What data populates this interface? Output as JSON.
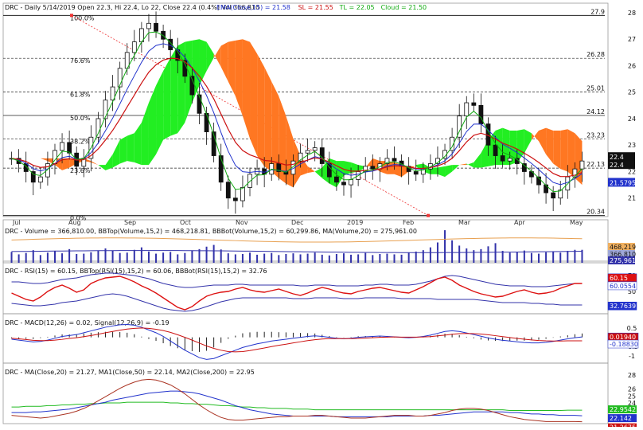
{
  "colors": {
    "candle": "#111111",
    "ema": "#2233cc",
    "sl": "#cc1111",
    "tl": "#11aa11",
    "cloud_green": "#22ee22",
    "cloud_orange": "#ff7722",
    "volume_bar": "#3333aa",
    "bb_upper": "#e8a050",
    "bb_lower": "#3333aa",
    "rsi": "#dd1111",
    "macd": "#2233cc",
    "signal": "#cc1111",
    "ma20": "#aa3322",
    "ma50": "#2233cc",
    "ma200": "#22bb22",
    "fib_line": "#222222",
    "trend_dotted": "#ee3333"
  },
  "chart_data": [
    {
      "type": "candlestick",
      "title": "DRC - Daily 5/14/2019 Open 22.3, Hi 22.4, Lo 22, Close 22.4 (0.4%) Vol 366,810",
      "legend": [
        {
          "text": "EMA(Close,15) = 21.58",
          "color": "#2233cc"
        },
        {
          "text": "SL = 21.55",
          "color": "#cc1111"
        },
        {
          "text": "TL = 22.05",
          "color": "#11aa11"
        },
        {
          "text": "Cloud = 21.50",
          "color": "#11aa11"
        }
      ],
      "x_labels": [
        "Jul",
        "Aug",
        "Sep",
        "Oct",
        "Nov",
        "Dec",
        "2019",
        "Feb",
        "Mar",
        "Apr",
        "May"
      ],
      "y_ticks": [
        21,
        22,
        23,
        24,
        25,
        26,
        27,
        28
      ],
      "ylim": [
        20.3,
        28.0
      ],
      "last_values": [
        "22.4",
        "22.4",
        "21.5795"
      ],
      "fib_levels": [
        {
          "label": "100.0%",
          "value": 27.9
        },
        {
          "label": "76.6%",
          "value": 26.28
        },
        {
          "label": "61.8%",
          "value": 25.01
        },
        {
          "label": "50.0%",
          "value": 24.12
        },
        {
          "label": "38.2%",
          "value": 23.23
        },
        {
          "label": "23.6%",
          "value": 22.13
        },
        {
          "label": "0.0%",
          "value": 20.34
        }
      ],
      "close_series": [
        22.5,
        22.3,
        22.0,
        21.6,
        21.8,
        22.3,
        22.8,
        23.1,
        22.7,
        22.2,
        22.5,
        23.3,
        24.0,
        24.7,
        25.2,
        25.9,
        26.5,
        26.9,
        27.4,
        27.6,
        27.3,
        27.0,
        26.6,
        26.2,
        25.6,
        24.9,
        24.2,
        23.5,
        22.6,
        21.6,
        21.0,
        20.9,
        21.4,
        21.9,
        22.1,
        21.9,
        22.3,
        22.0,
        21.9,
        22.4,
        22.7,
        22.8,
        22.9,
        22.3,
        21.8,
        21.6,
        21.5,
        21.7,
        22.0,
        22.2,
        22.1,
        22.3,
        22.5,
        22.4,
        22.2,
        22.0,
        21.9,
        22.1,
        22.3,
        22.5,
        22.8,
        23.3,
        24.1,
        24.6,
        24.5,
        23.8,
        23.0,
        22.6,
        22.4,
        22.5,
        22.3,
        22.0,
        21.8,
        21.5,
        21.2,
        21.0,
        21.3,
        21.8,
        22.1,
        22.4
      ]
    },
    {
      "type": "bar",
      "title": "DRC - Volume = 366,810.00, BBTop(Volume,15,2) = 468,218.81, BBBot(Volume,15,2) = 60,299.86, MA(Volume,20) = 275,961.00",
      "last_values": [
        "468,219",
        "366,810",
        "275,961"
      ],
      "values": [
        3.1,
        2.4,
        2.8,
        3.6,
        2.2,
        2.9,
        3.3,
        2.7,
        3.9,
        2.5,
        2.6,
        3.0,
        3.4,
        4.1,
        3.5,
        2.8,
        2.9,
        3.7,
        4.4,
        3.2,
        2.6,
        2.9,
        3.1,
        2.4,
        2.8,
        3.5,
        3.9,
        4.6,
        5.1,
        3.8,
        2.7,
        2.4,
        2.5,
        2.9,
        2.3,
        2.6,
        2.8,
        2.2,
        2.5,
        2.7,
        2.4,
        2.6,
        2.9,
        2.3,
        2.1,
        2.5,
        2.7,
        2.3,
        2.4,
        2.8,
        2.2,
        2.5,
        2.6,
        2.4,
        2.3,
        2.9,
        3.2,
        3.6,
        4.4,
        5.8,
        9.3,
        6.4,
        4.9,
        4.1,
        3.6,
        3.9,
        4.7,
        5.6,
        3.4,
        2.9,
        3.1,
        3.5,
        2.8,
        2.6,
        3.0,
        3.3,
        2.9,
        3.4,
        3.7,
        3.7
      ],
      "ylim": [
        0,
        10
      ]
    },
    {
      "type": "line",
      "title": "DRC - RSI(15) = 60.15, BBTop(RSI(15),15,2) = 60.06, BBBot(RSI(15),15,2) = 32.76",
      "y_ticks": [
        30,
        50,
        70
      ],
      "ylim": [
        22,
        78
      ],
      "last_values": [
        "60.15",
        "60.0554",
        "32.7639"
      ],
      "rsi": [
        48,
        44,
        40,
        38,
        43,
        50,
        55,
        58,
        54,
        49,
        52,
        60,
        64,
        67,
        68,
        69,
        66,
        62,
        57,
        53,
        48,
        42,
        36,
        30,
        27,
        31,
        38,
        44,
        47,
        49,
        50,
        53,
        55,
        52,
        50,
        49,
        51,
        53,
        50,
        47,
        45,
        48,
        52,
        55,
        53,
        50,
        48,
        47,
        50,
        52,
        54,
        55,
        53,
        51,
        49,
        48,
        52,
        56,
        61,
        66,
        68,
        64,
        58,
        54,
        50,
        47,
        45,
        43,
        44,
        47,
        50,
        52,
        49,
        47,
        48,
        50,
        54,
        57,
        60,
        60
      ],
      "bb_top": [
        62,
        62,
        61,
        60,
        60,
        61,
        63,
        65,
        66,
        67,
        69,
        71,
        72,
        73,
        73,
        72,
        71,
        70,
        68,
        66,
        63,
        60,
        58,
        56,
        55,
        55,
        56,
        57,
        58,
        58,
        58,
        59,
        59,
        58,
        58,
        58,
        58,
        58,
        58,
        58,
        57,
        57,
        58,
        58,
        58,
        57,
        57,
        57,
        57,
        58,
        58,
        59,
        59,
        58,
        58,
        58,
        59,
        61,
        63,
        66,
        69,
        70,
        69,
        67,
        65,
        63,
        61,
        59,
        58,
        57,
        57,
        57,
        56,
        56,
        56,
        57,
        58,
        59,
        60,
        60
      ],
      "bb_bot": [
        35,
        34,
        33,
        32,
        32,
        33,
        34,
        36,
        37,
        38,
        40,
        42,
        44,
        46,
        47,
        46,
        44,
        41,
        38,
        35,
        32,
        29,
        27,
        26,
        25,
        26,
        28,
        31,
        34,
        37,
        39,
        41,
        42,
        42,
        42,
        42,
        42,
        42,
        42,
        41,
        41,
        41,
        42,
        42,
        42,
        42,
        41,
        41,
        41,
        42,
        42,
        42,
        42,
        42,
        41,
        41,
        41,
        41,
        41,
        40,
        40,
        40,
        40,
        40,
        40,
        39,
        38,
        37,
        36,
        36,
        36,
        36,
        35,
        35,
        34,
        34,
        33,
        33,
        33,
        33
      ]
    },
    {
      "type": "bar",
      "title": "DRC - MACD(12,26) = 0.02, Signal(12,26,9) = -0.19",
      "y_ticks": [
        0.5,
        0,
        -0.5,
        -1.0
      ],
      "ylim": [
        -1.4,
        0.85
      ],
      "last_values": [
        "0.01940",
        "-0.18830"
      ],
      "macd": [
        -0.1,
        -0.15,
        -0.2,
        -0.25,
        -0.22,
        -0.15,
        -0.05,
        0.05,
        0.1,
        0.15,
        0.25,
        0.35,
        0.45,
        0.55,
        0.62,
        0.68,
        0.7,
        0.66,
        0.55,
        0.4,
        0.25,
        0.05,
        -0.2,
        -0.45,
        -0.7,
        -0.9,
        -1.1,
        -1.2,
        -1.15,
        -1.0,
        -0.85,
        -0.7,
        -0.55,
        -0.45,
        -0.35,
        -0.28,
        -0.2,
        -0.15,
        -0.1,
        -0.05,
        0.0,
        0.05,
        0.08,
        0.05,
        0.0,
        -0.05,
        -0.08,
        -0.05,
        0.0,
        0.03,
        0.05,
        0.07,
        0.05,
        0.03,
        0.0,
        -0.02,
        0.0,
        0.05,
        0.12,
        0.22,
        0.32,
        0.36,
        0.32,
        0.24,
        0.15,
        0.06,
        -0.03,
        -0.1,
        -0.16,
        -0.2,
        -0.24,
        -0.28,
        -0.3,
        -0.3,
        -0.27,
        -0.22,
        -0.15,
        -0.08,
        -0.02,
        0.02
      ],
      "signal": [
        -0.05,
        -0.08,
        -0.12,
        -0.16,
        -0.18,
        -0.18,
        -0.15,
        -0.11,
        -0.06,
        -0.02,
        0.04,
        0.1,
        0.17,
        0.25,
        0.32,
        0.39,
        0.45,
        0.49,
        0.51,
        0.49,
        0.44,
        0.37,
        0.27,
        0.14,
        0.0,
        -0.15,
        -0.31,
        -0.47,
        -0.6,
        -0.7,
        -0.77,
        -0.79,
        -0.77,
        -0.72,
        -0.65,
        -0.58,
        -0.5,
        -0.43,
        -0.37,
        -0.3,
        -0.24,
        -0.18,
        -0.13,
        -0.09,
        -0.07,
        -0.07,
        -0.07,
        -0.07,
        -0.06,
        -0.04,
        -0.02,
        0.0,
        0.01,
        0.02,
        0.01,
        0.01,
        0.01,
        0.02,
        0.04,
        0.08,
        0.12,
        0.17,
        0.2,
        0.21,
        0.2,
        0.18,
        0.14,
        0.09,
        0.04,
        -0.01,
        -0.06,
        -0.1,
        -0.14,
        -0.17,
        -0.19,
        -0.2,
        -0.2,
        -0.19,
        -0.19,
        -0.19
      ]
    },
    {
      "type": "line",
      "title": "DRC - MA(Close,20) = 21.27, MA1(Close,50) = 22.14, MA2(Close,200) = 22.95",
      "y_ticks": [
        28,
        26,
        25,
        24,
        23
      ],
      "ylim": [
        21.0,
        28.6
      ],
      "last_values": [
        "22.9542",
        "22.142",
        "21.2675"
      ],
      "ma20": [
        22.2,
        22.1,
        22.0,
        21.9,
        21.8,
        21.9,
        22.1,
        22.3,
        22.5,
        22.8,
        23.2,
        23.7,
        24.3,
        24.9,
        25.5,
        26.1,
        26.6,
        27.0,
        27.3,
        27.4,
        27.3,
        27.0,
        26.6,
        26.0,
        25.3,
        24.5,
        23.7,
        23.0,
        22.4,
        21.9,
        21.6,
        21.5,
        21.5,
        21.6,
        21.7,
        21.8,
        21.9,
        22.0,
        22.0,
        22.1,
        22.1,
        22.1,
        22.2,
        22.2,
        22.1,
        22.0,
        21.9,
        21.8,
        21.8,
        21.8,
        21.9,
        22.0,
        22.1,
        22.2,
        22.2,
        22.2,
        22.1,
        22.1,
        22.2,
        22.4,
        22.6,
        22.9,
        23.1,
        23.2,
        23.2,
        23.1,
        22.9,
        22.6,
        22.3,
        22.0,
        21.8,
        21.6,
        21.5,
        21.4,
        21.3,
        21.3,
        21.3,
        21.3,
        21.3,
        21.27
      ],
      "ma50": [
        22.6,
        22.6,
        22.6,
        22.7,
        22.7,
        22.8,
        22.9,
        23.0,
        23.1,
        23.3,
        23.5,
        23.7,
        23.9,
        24.1,
        24.4,
        24.6,
        24.8,
        25.0,
        25.2,
        25.4,
        25.5,
        25.6,
        25.7,
        25.7,
        25.6,
        25.5,
        25.3,
        25.0,
        24.7,
        24.4,
        24.0,
        23.6,
        23.3,
        23.0,
        22.8,
        22.6,
        22.4,
        22.3,
        22.2,
        22.1,
        22.1,
        22.1,
        22.1,
        22.1,
        22.1,
        22.0,
        22.0,
        22.0,
        22.0,
        22.0,
        22.0,
        22.0,
        22.0,
        22.1,
        22.1,
        22.1,
        22.1,
        22.1,
        22.2,
        22.2,
        22.3,
        22.4,
        22.5,
        22.6,
        22.7,
        22.7,
        22.7,
        22.7,
        22.7,
        22.6,
        22.6,
        22.5,
        22.4,
        22.4,
        22.3,
        22.3,
        22.2,
        22.2,
        22.2,
        22.14
      ],
      "ma200": [
        23.4,
        23.4,
        23.5,
        23.5,
        23.5,
        23.6,
        23.6,
        23.7,
        23.7,
        23.8,
        23.8,
        23.9,
        23.9,
        24.0,
        24.0,
        24.0,
        24.1,
        24.1,
        24.1,
        24.1,
        24.1,
        24.1,
        24.0,
        24.0,
        23.9,
        23.9,
        23.8,
        23.8,
        23.7,
        23.6,
        23.6,
        23.5,
        23.4,
        23.4,
        23.3,
        23.3,
        23.2,
        23.2,
        23.2,
        23.1,
        23.1,
        23.1,
        23.0,
        23.0,
        23.0,
        23.0,
        23.0,
        23.0,
        23.0,
        23.0,
        23.0,
        23.0,
        23.0,
        23.0,
        23.0,
        23.0,
        23.0,
        23.0,
        23.0,
        23.0,
        23.0,
        23.0,
        23.0,
        23.0,
        23.0,
        23.0,
        23.0,
        23.0,
        23.0,
        22.9,
        22.9,
        22.9,
        22.9,
        22.9,
        22.9,
        22.9,
        22.9,
        22.95,
        22.95,
        22.95
      ]
    }
  ]
}
